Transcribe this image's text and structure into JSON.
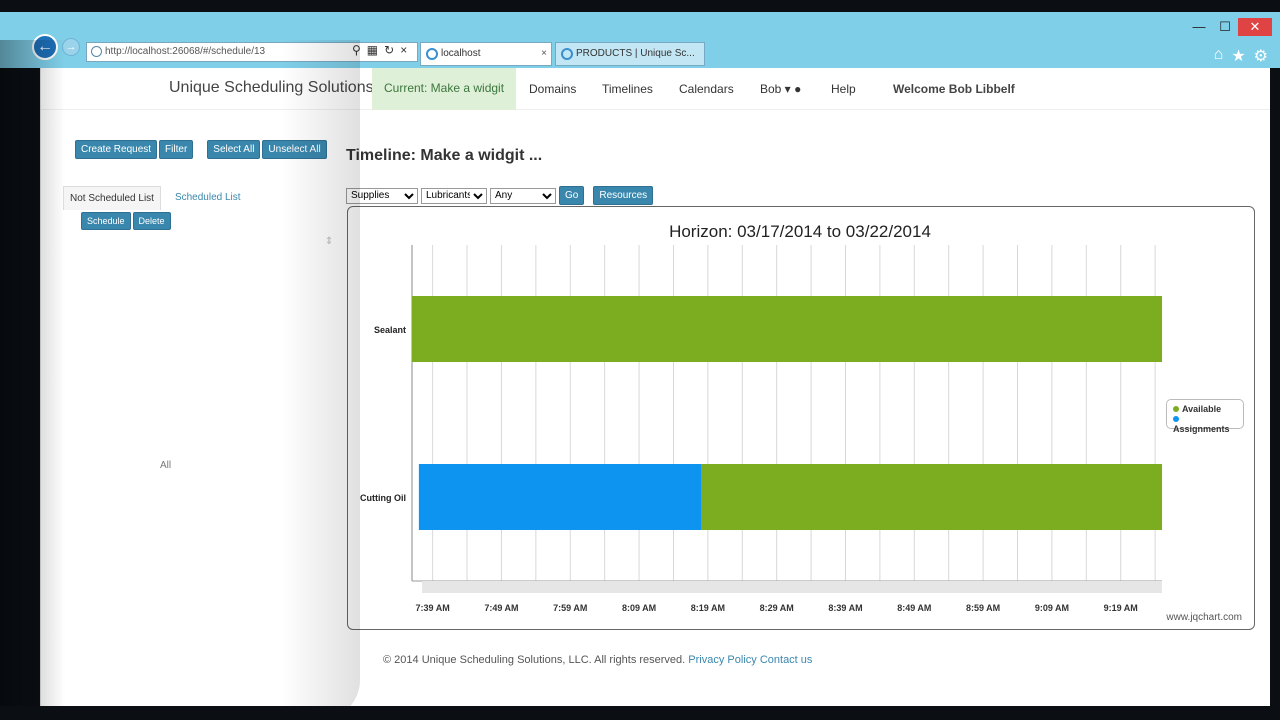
{
  "browser": {
    "address": "http://localhost:26068/#/schedule/13",
    "tabs": [
      {
        "label": "localhost"
      },
      {
        "label": "PRODUCTS | Unique Sc..."
      }
    ],
    "window_controls": {
      "minimize": "—",
      "maximize": "☐",
      "close": "✕"
    }
  },
  "nav": {
    "brand": "Unique Scheduling Solutions",
    "current": "Current: Make a widgit",
    "items": [
      "Domains",
      "Timelines",
      "Calendars",
      "Bob ▾",
      "Help"
    ],
    "welcome": "Welcome Bob Libbelf"
  },
  "sidebar": {
    "buttons": [
      "Create Request",
      "Filter",
      "Select All",
      "Unselect All"
    ],
    "tabs": [
      "Not Scheduled List",
      "Scheduled List"
    ],
    "row_buttons": [
      "Schedule",
      "Delete"
    ],
    "note": "All"
  },
  "main": {
    "title": "Timeline: Make a widgit ...",
    "filters": {
      "category": "Supplies",
      "type": "Lubricants",
      "scope": "Any",
      "go": "Go",
      "resources": "Resources"
    }
  },
  "chart_data": {
    "type": "bar",
    "title": "Horizon: 03/17/2014 to 03/22/2014",
    "categories": [
      "Sealant",
      "Cutting Oil"
    ],
    "x_tick_labels": [
      "7:39 AM",
      "7:49 AM",
      "7:59 AM",
      "8:09 AM",
      "8:19 AM",
      "8:29 AM",
      "8:39 AM",
      "8:49 AM",
      "8:59 AM",
      "9:09 AM",
      "9:19 AM"
    ],
    "xlim": [
      "7:36 AM",
      "9:25 AM"
    ],
    "series": [
      {
        "name": "Available",
        "color": "#7cac1f",
        "ranges": [
          {
            "category": "Sealant",
            "start": "7:36 AM",
            "end": "9:25 AM"
          },
          {
            "category": "Cutting Oil",
            "start": "8:18 AM",
            "end": "9:25 AM"
          }
        ]
      },
      {
        "name": "Assignments",
        "color": "#0d94f0",
        "ranges": [
          {
            "category": "Cutting Oil",
            "start": "7:37 AM",
            "end": "8:18 AM"
          }
        ]
      }
    ],
    "legend_position": "right",
    "grid": true,
    "credit": "www.jqchart.com"
  },
  "footer": {
    "copyright": "© 2014 Unique Scheduling Solutions, LLC. All rights reserved.",
    "privacy": "Privacy Policy",
    "contact": "Contact us"
  }
}
